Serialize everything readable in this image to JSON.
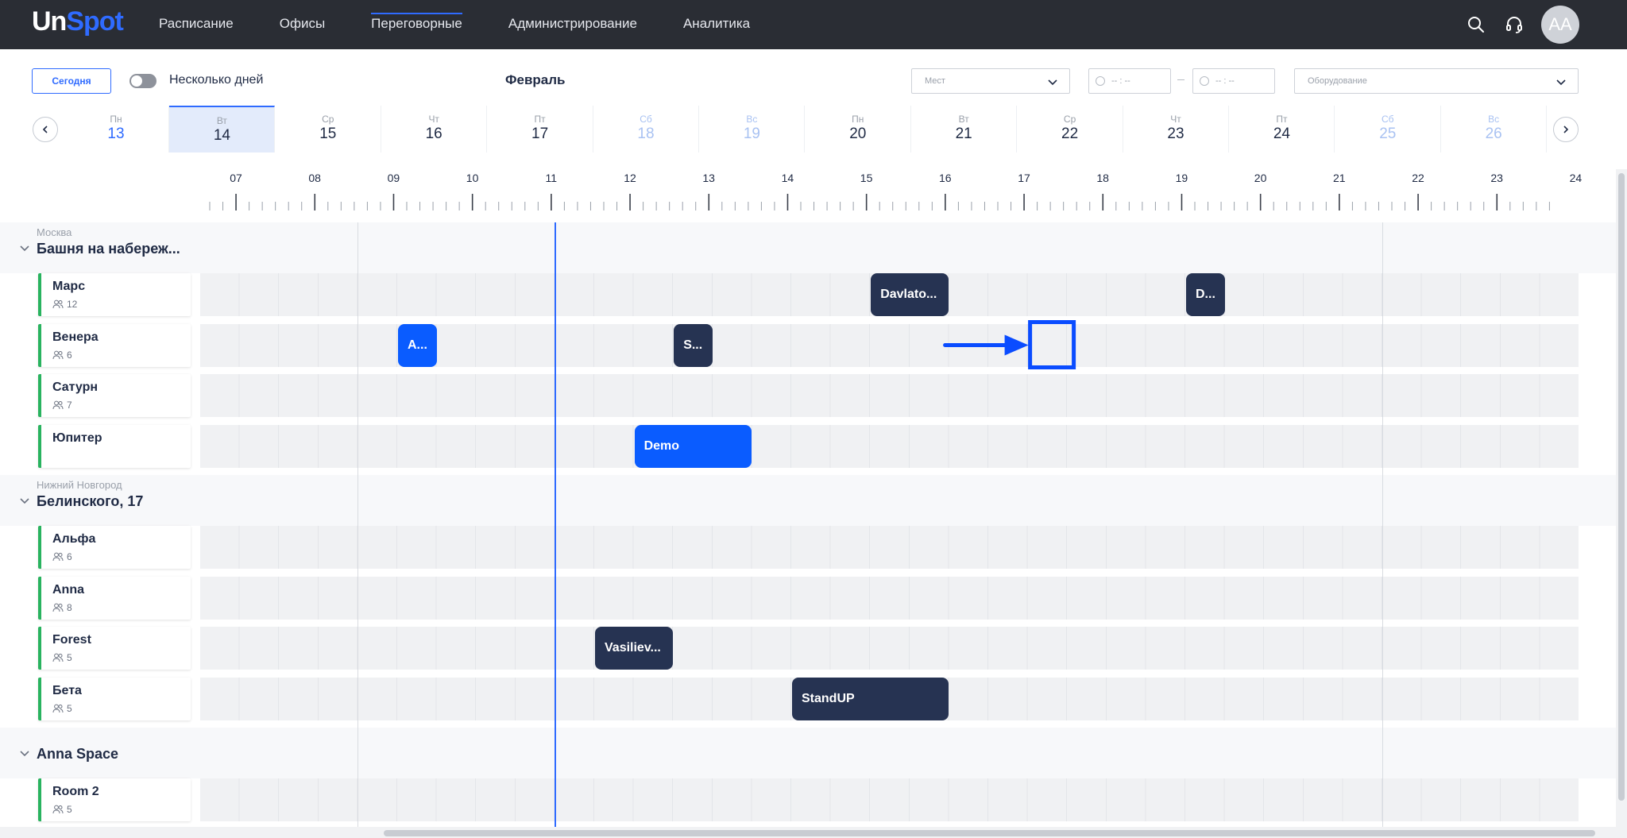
{
  "app": {
    "logo_un": "Un",
    "logo_spot": "Spot"
  },
  "nav": [
    {
      "label": "Расписание"
    },
    {
      "label": "Офисы"
    },
    {
      "label": "Переговорные"
    },
    {
      "label": "Администрирование"
    },
    {
      "label": "Аналитика"
    }
  ],
  "user": {
    "initials": "AA"
  },
  "toolbar": {
    "today_label": "Сегодня",
    "multi_day_label": "Несколько дней",
    "month": "Февраль",
    "seats_placeholder": "Мест",
    "time_from_placeholder": "-- : --",
    "time_to_placeholder": "-- : --",
    "equipment_placeholder": "Оборудование"
  },
  "days": [
    {
      "wd": "Пн",
      "dn": "13"
    },
    {
      "wd": "Вт",
      "dn": "14"
    },
    {
      "wd": "Ср",
      "dn": "15"
    },
    {
      "wd": "Чт",
      "dn": "16"
    },
    {
      "wd": "Пт",
      "dn": "17"
    },
    {
      "wd": "Сб",
      "dn": "18"
    },
    {
      "wd": "Вс",
      "dn": "19"
    },
    {
      "wd": "Пн",
      "dn": "20"
    },
    {
      "wd": "Вт",
      "dn": "21"
    },
    {
      "wd": "Ср",
      "dn": "22"
    },
    {
      "wd": "Чт",
      "dn": "23"
    },
    {
      "wd": "Пт",
      "dn": "24"
    },
    {
      "wd": "Сб",
      "dn": "25"
    },
    {
      "wd": "Вс",
      "dn": "26"
    }
  ],
  "hours": [
    "07",
    "08",
    "09",
    "10",
    "11",
    "12",
    "13",
    "14",
    "15",
    "16",
    "17",
    "18",
    "19",
    "20",
    "21",
    "22",
    "23",
    "24"
  ],
  "sections": [
    {
      "city": "Москва",
      "name": "Башня на набереж...",
      "rooms": [
        {
          "name": "Марс",
          "capacity": "12"
        },
        {
          "name": "Венера",
          "capacity": "6"
        },
        {
          "name": "Сатурн",
          "capacity": "7"
        },
        {
          "name": "Юпитер",
          "capacity": ""
        }
      ]
    },
    {
      "city": "Нижний Новгород",
      "name": "Белинского, 17",
      "rooms": [
        {
          "name": "Альфа",
          "capacity": "6"
        },
        {
          "name": "Anna",
          "capacity": "8"
        },
        {
          "name": "Forest",
          "capacity": "5"
        },
        {
          "name": "Бета",
          "capacity": "5"
        }
      ]
    },
    {
      "city": "",
      "name": "Anna Space",
      "rooms": [
        {
          "name": "Room 2",
          "capacity": "5"
        }
      ]
    }
  ],
  "events": [
    {
      "title": "Davlato...",
      "room": "Марс",
      "start": "15:30",
      "end": "16:30",
      "color": "#263352"
    },
    {
      "title": "D...",
      "room": "Марс",
      "start": "19:30",
      "end": "20:00",
      "color": "#263352"
    },
    {
      "title": "A...",
      "room": "Венера",
      "start": "09:30",
      "end": "10:00",
      "color": "#0a5cff"
    },
    {
      "title": "S...",
      "room": "Венера",
      "start": "13:00",
      "end": "13:30",
      "color": "#263352"
    },
    {
      "title": "Demo",
      "room": "Юпитер",
      "start": "12:30",
      "end": "14:00",
      "color": "#0a5cff"
    },
    {
      "title": "Vasiliev...",
      "room": "Forest",
      "start": "12:00",
      "end": "13:00",
      "color": "#263352"
    },
    {
      "title": "StandUP",
      "room": "Бета",
      "start": "14:30",
      "end": "16:30",
      "color": "#263352"
    }
  ],
  "colors": {
    "accent": "#2f6bff",
    "room_marker": "#29b35f",
    "topbar": "#2a2d34"
  }
}
